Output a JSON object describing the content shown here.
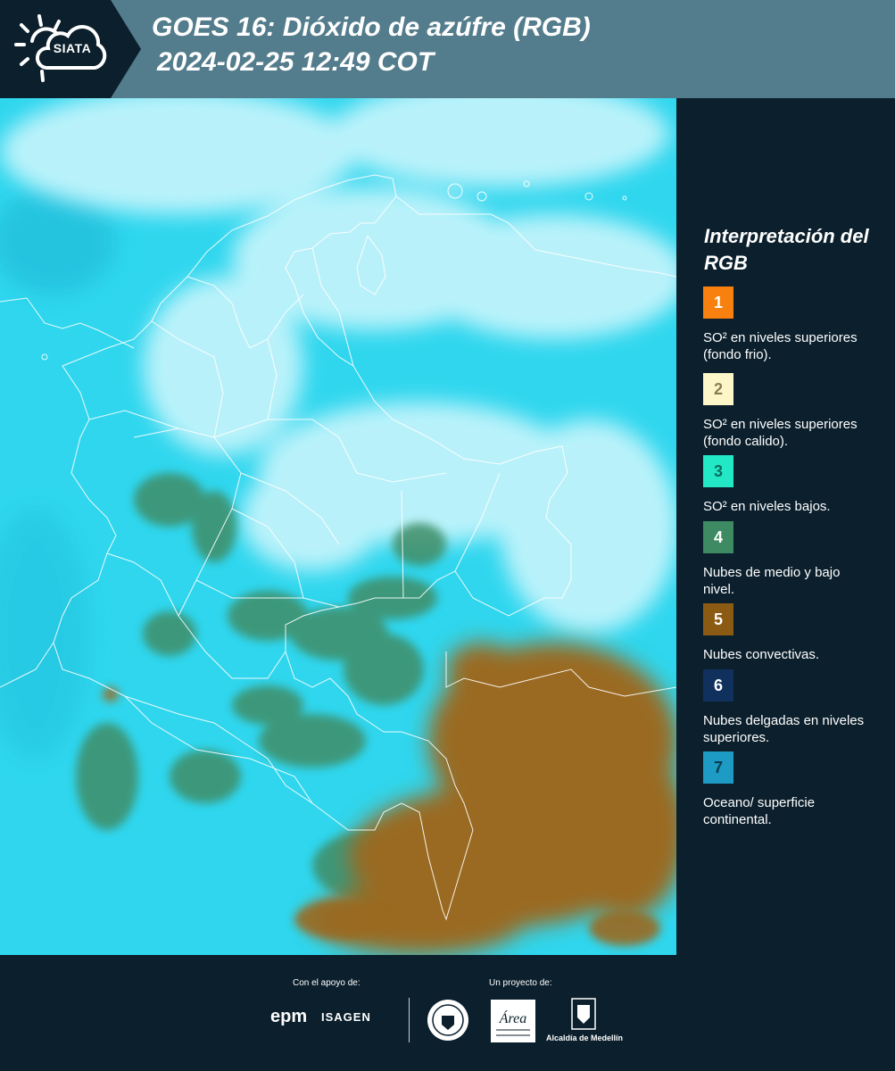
{
  "header": {
    "logo_text": "SIATA",
    "title": "GOES 16: Dióxido de azúfre (RGB)",
    "timestamp": "2024-02-25 12:49 COT"
  },
  "map": {
    "colors": {
      "ocean_cyan": "#2ed8f0",
      "cloud_white": "#cdf6fc",
      "low_cloud_green": "#3f8e6a",
      "convective_brown": "#9a6a22",
      "borders": "#ffffff"
    }
  },
  "legend": {
    "title": "Interpretación del RGB",
    "items": [
      {
        "number": "1",
        "color": "#f7800e",
        "text_color": "#ffffff",
        "text": "SO² en niveles superiores (fondo frio)."
      },
      {
        "number": "2",
        "color": "#fdf6c8",
        "text_color": "#8a7d55",
        "text": "SO² en niveles superiores (fondo calido)."
      },
      {
        "number": "3",
        "color": "#23e8c6",
        "text_color": "#0d6e5f",
        "text": "SO² en niveles bajos."
      },
      {
        "number": "4",
        "color": "#3e8a62",
        "text_color": "#ffffff",
        "text": "Nubes de medio y bajo nivel."
      },
      {
        "number": "5",
        "color": "#8b5a13",
        "text_color": "#ffffff",
        "text": "Nubes convectivas."
      },
      {
        "number": "6",
        "color": "#10305e",
        "text_color": "#ffffff",
        "text": "Nubes delgadas en niveles superiores."
      },
      {
        "number": "7",
        "color": "#1d9bc4",
        "text_color": "#0b3d52",
        "text": "Oceano/ superficie continental."
      }
    ]
  },
  "footer": {
    "support_label": "Con el apoyo de:",
    "project_label": "Un proyecto de:",
    "epm": "epm",
    "isagen": "ISAGEN",
    "area_metropolitana": "Área",
    "alcaldia": "Alcaldía de Medellín"
  }
}
